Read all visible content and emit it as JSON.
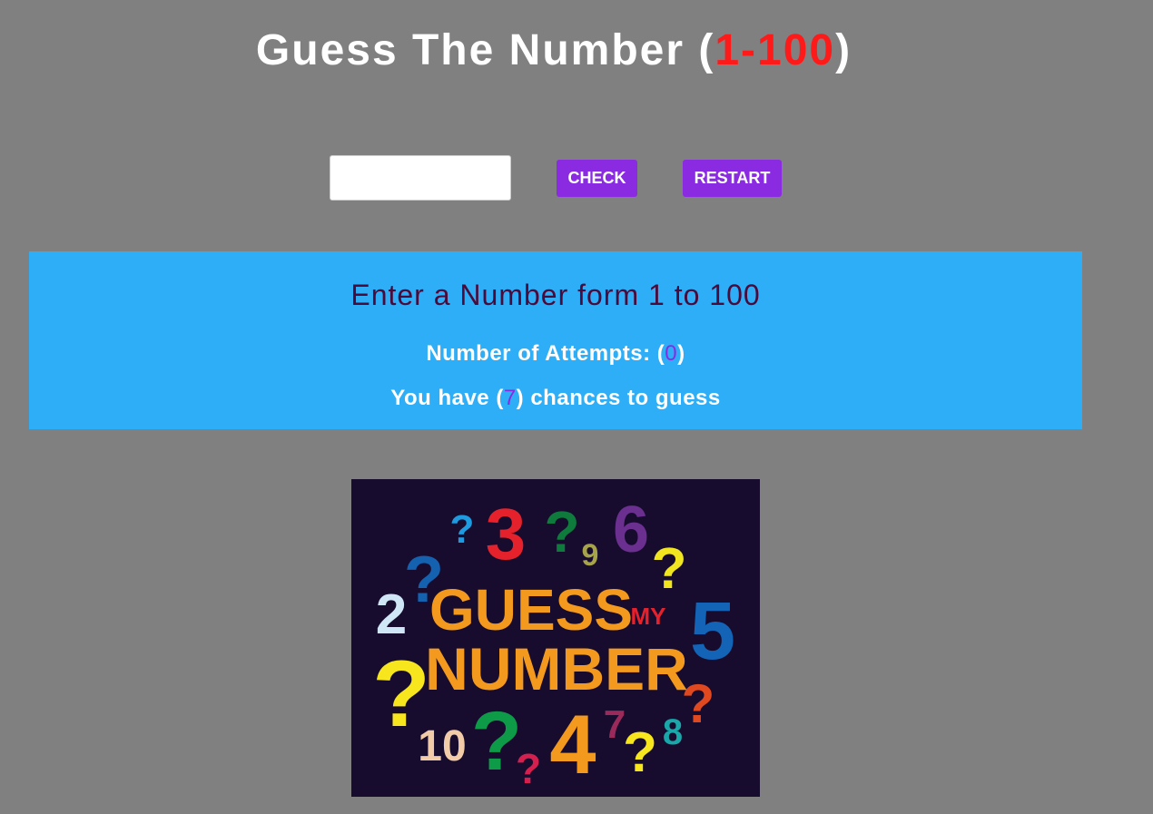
{
  "title": {
    "prefix": "Guess The Number (",
    "range": "1-100",
    "suffix": ")"
  },
  "controls": {
    "input_value": "",
    "input_placeholder": "",
    "check_label": "CHECK",
    "restart_label": "RESTART"
  },
  "info": {
    "message": "Enter a Number form 1 to 100",
    "attempts_prefix": "Number of Attempts: (",
    "attempts_value": "0",
    "attempts_suffix": ")",
    "chances_prefix": "You have (",
    "chances_value": "7",
    "chances_suffix": ") chances to guess"
  },
  "logo": {
    "line1": "GUESS",
    "small": "MY",
    "line2": "NUMBER"
  },
  "colors": {
    "background": "#808080",
    "accent_button": "#8a2be2",
    "panel": "#2eaef7",
    "range_red": "#ff1a1a"
  }
}
